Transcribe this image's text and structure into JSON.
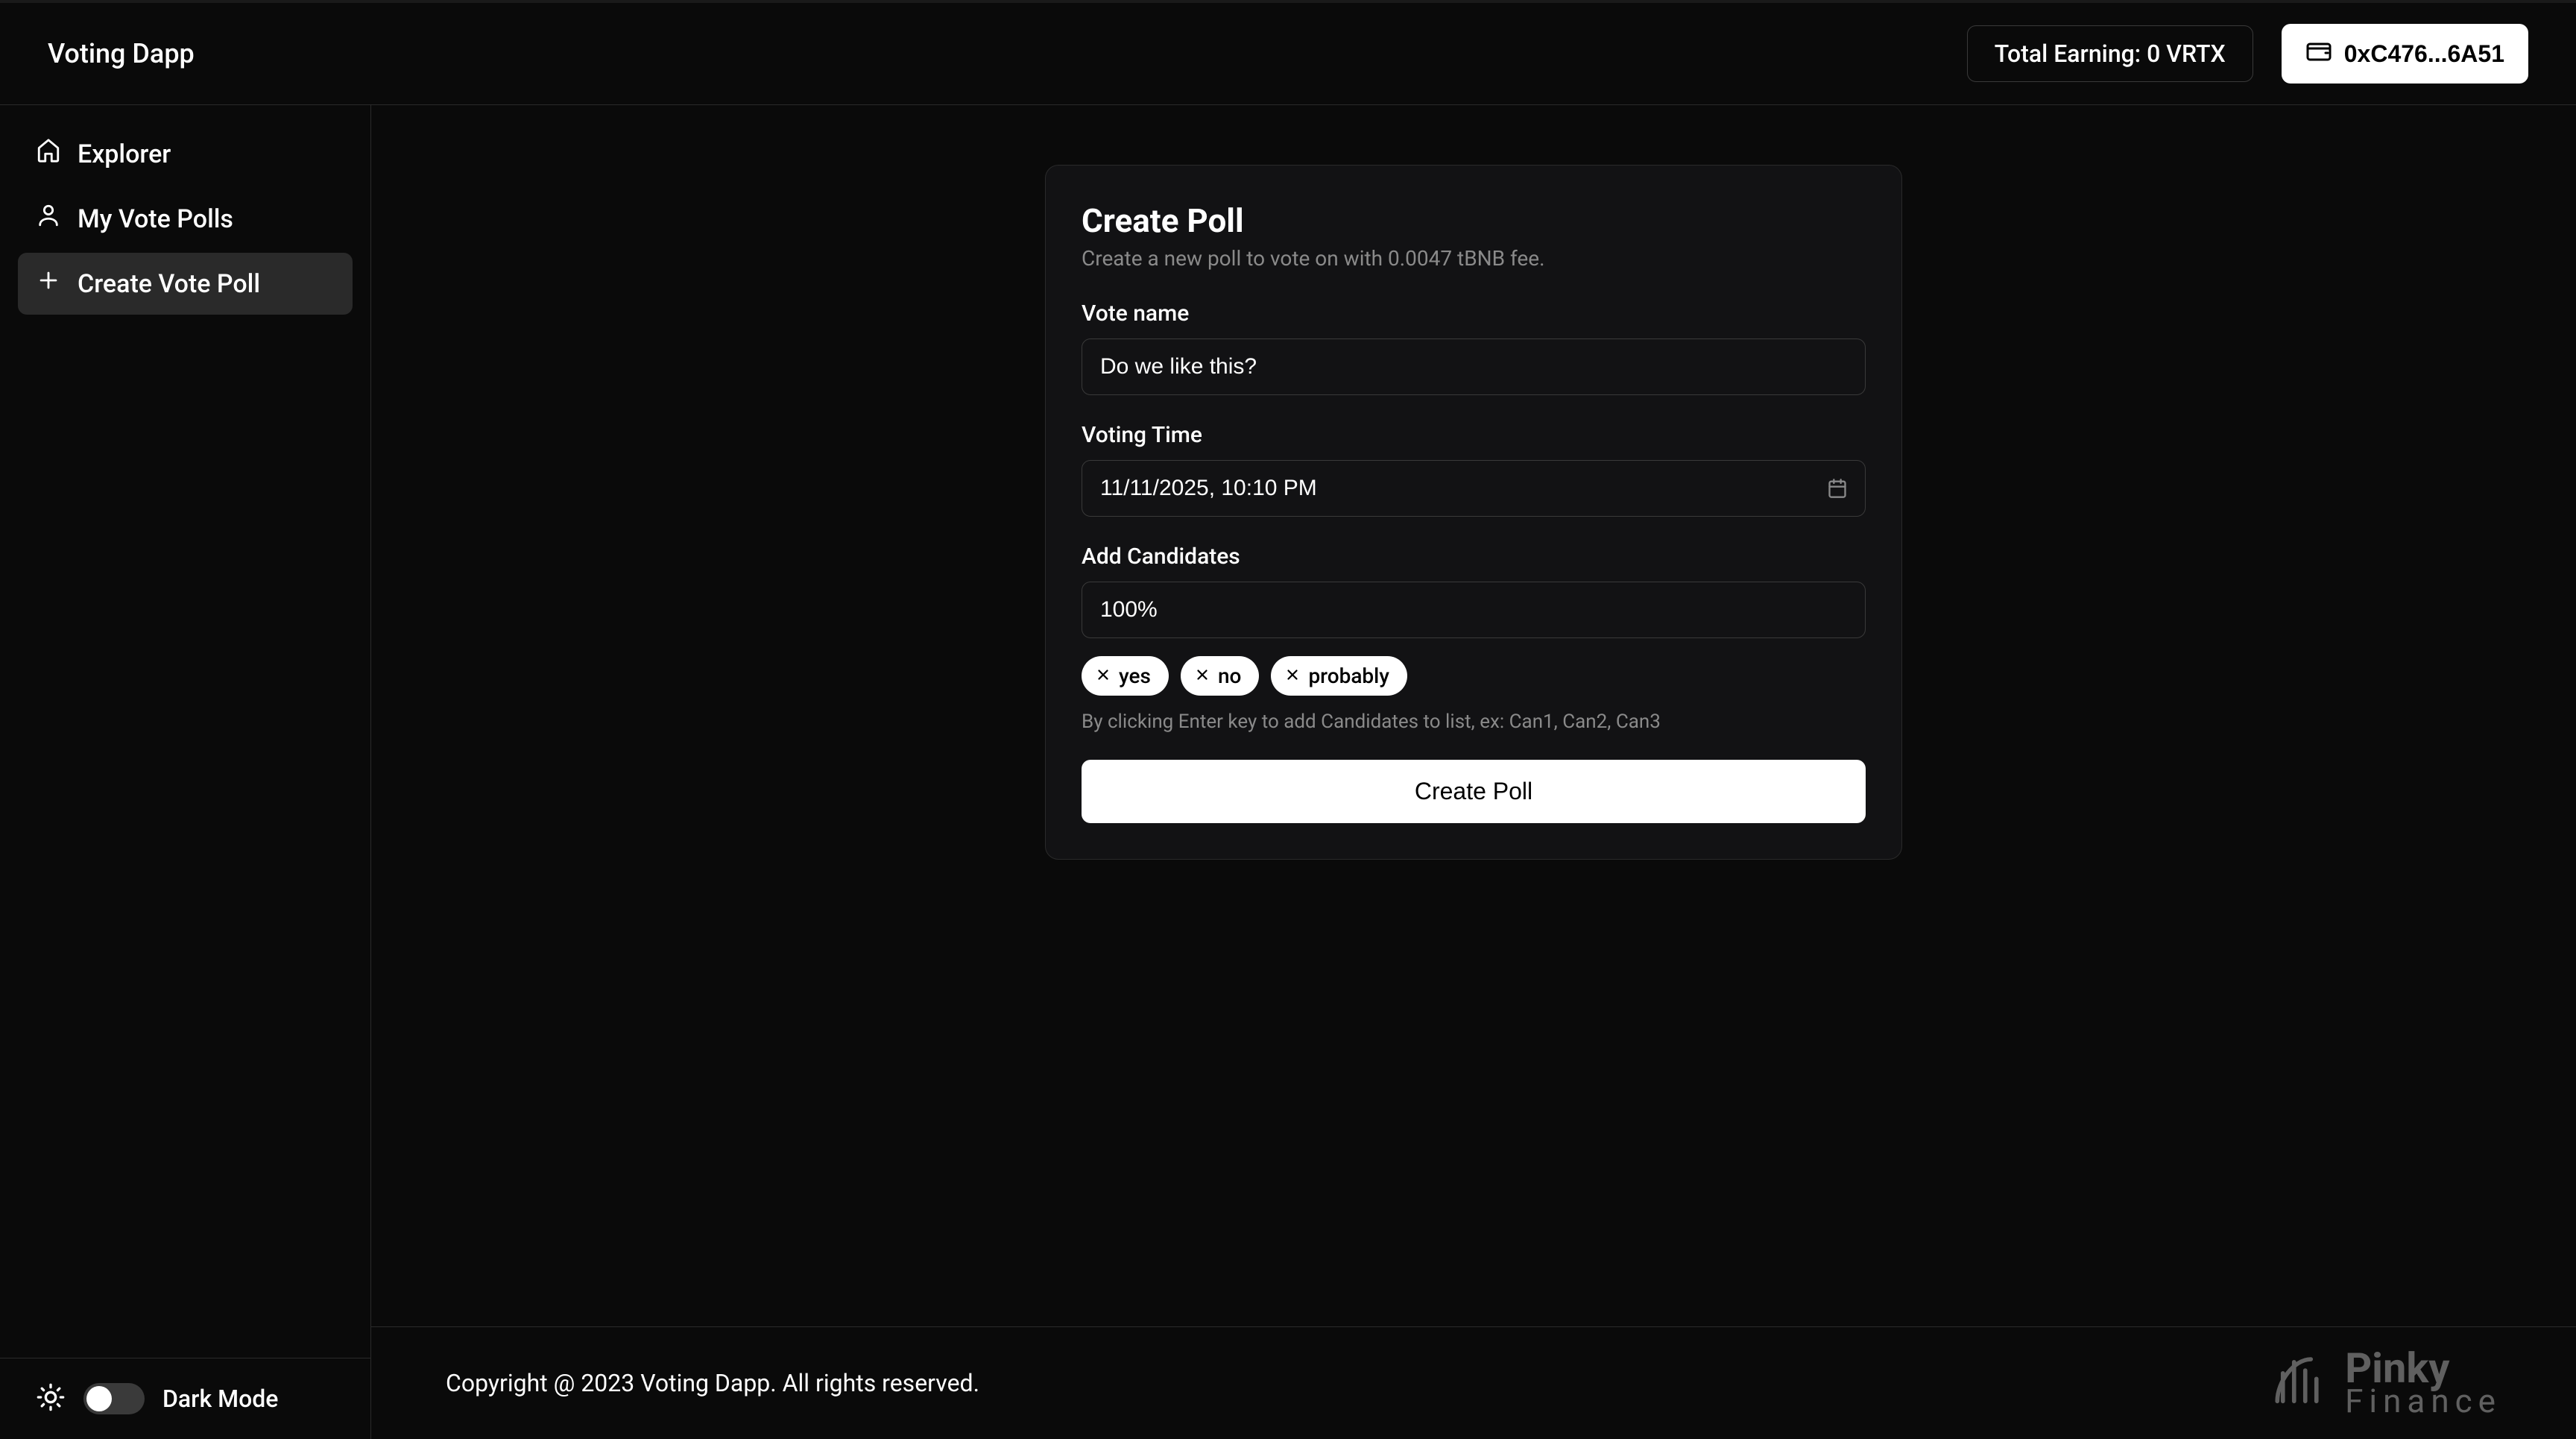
{
  "header": {
    "app_title": "Voting Dapp",
    "earning_label": "Total Earning: 0 VRTX",
    "wallet_address": "0xC476...6A51"
  },
  "sidebar": {
    "items": [
      {
        "label": "Explorer",
        "icon": "home-icon"
      },
      {
        "label": "My Vote Polls",
        "icon": "user-icon"
      },
      {
        "label": "Create Vote Poll",
        "icon": "plus-icon"
      }
    ],
    "dark_mode_label": "Dark Mode"
  },
  "form": {
    "title": "Create Poll",
    "subtitle": "Create a new poll to vote on with 0.0047 tBNB fee.",
    "vote_name_label": "Vote name",
    "vote_name_value": "Do we like this?",
    "voting_time_label": "Voting Time",
    "voting_time_value": "11/11/2025, 10:10 PM",
    "candidates_label": "Add Candidates",
    "candidates_input_value": "100%",
    "candidates": [
      "yes",
      "no",
      "probably"
    ],
    "helper_text": "By clicking Enter key to add Candidates to list, ex: Can1, Can2, Can3",
    "submit_label": "Create Poll"
  },
  "footer": {
    "copyright": "Copyright @ 2023 Voting Dapp. All rights reserved.",
    "brand_name": "Pinky",
    "brand_sub": "Finance"
  }
}
